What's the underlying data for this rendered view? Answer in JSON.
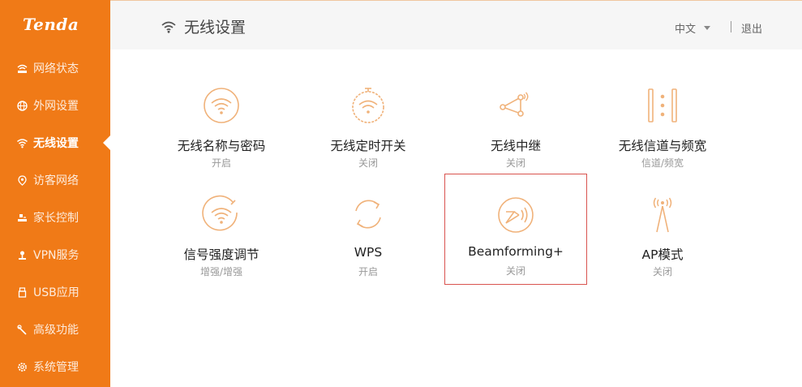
{
  "brand": {
    "logo_text": "Tenda",
    "accent": "#f07a17",
    "icon_color": "#f0b27a"
  },
  "sidebar": {
    "items": [
      {
        "label": "网络状态",
        "icon": "network-status-icon"
      },
      {
        "label": "外网设置",
        "icon": "globe-icon"
      },
      {
        "label": "无线设置",
        "icon": "wifi-icon",
        "active": true
      },
      {
        "label": "访客网络",
        "icon": "guest-icon"
      },
      {
        "label": "家长控制",
        "icon": "parental-control-icon"
      },
      {
        "label": "VPN服务",
        "icon": "vpn-icon"
      },
      {
        "label": "USB应用",
        "icon": "usb-icon"
      },
      {
        "label": "高级功能",
        "icon": "tools-icon"
      },
      {
        "label": "系统管理",
        "icon": "gear-icon"
      }
    ]
  },
  "header": {
    "title": "无线设置",
    "language": "中文",
    "logout": "退出"
  },
  "tiles": [
    {
      "label": "无线名称与密码",
      "status": "开启",
      "icon": "wifi-circle-icon"
    },
    {
      "label": "无线定时开关",
      "status": "关闭",
      "icon": "wifi-timer-icon"
    },
    {
      "label": "无线中继",
      "status": "关闭",
      "icon": "repeater-icon"
    },
    {
      "label": "无线信道与频宽",
      "status": "信道/频宽",
      "icon": "channel-bandwidth-icon"
    },
    {
      "label": "信号强度调节",
      "status": "增强/增强",
      "icon": "signal-strength-icon"
    },
    {
      "label": "WPS",
      "status": "开启",
      "icon": "wps-icon"
    },
    {
      "label": "Beamforming+",
      "status": "关闭",
      "icon": "beamforming-icon",
      "selected": true
    },
    {
      "label": "AP模式",
      "status": "关闭",
      "icon": "ap-antenna-icon"
    }
  ]
}
